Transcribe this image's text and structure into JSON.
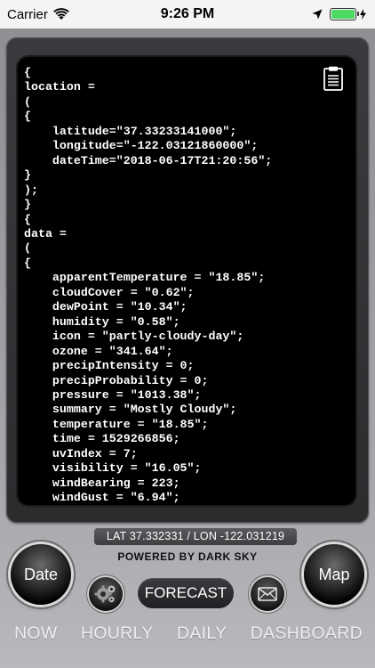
{
  "status_bar": {
    "carrier": "Carrier",
    "time": "9:26 PM"
  },
  "code": {
    "lines": [
      "{",
      "location =",
      "(",
      "{",
      "    latitude=\"37.33233141000\";",
      "    longitude=\"-122.03121860000\";",
      "    dateTime=\"2018-06-17T21:20:56\";",
      "}",
      ");",
      "}",
      "{",
      "data =",
      "(",
      "{",
      "    apparentTemperature = \"18.85\";",
      "    cloudCover = \"0.62\";",
      "    dewPoint = \"10.34\";",
      "    humidity = \"0.58\";",
      "    icon = \"partly-cloudy-day\";",
      "    ozone = \"341.64\";",
      "    precipIntensity = 0;",
      "    precipProbability = 0;",
      "    pressure = \"1013.38\";",
      "    summary = \"Mostly Cloudy\";",
      "    temperature = \"18.85\";",
      "    time = 1529266856;",
      "    uvIndex = 7;",
      "    visibility = \"16.05\";",
      "    windBearing = 223;",
      "    windGust = \"6.94\";"
    ]
  },
  "latlon": "LAT 37.332331 / LON -122.031219",
  "powered_by": "POWERED BY DARK SKY",
  "buttons": {
    "date": "Date",
    "map": "Map",
    "forecast": "FORECAST"
  },
  "tabs": [
    "NOW",
    "HOURLY",
    "DAILY",
    "DASHBOARD"
  ],
  "colors": {
    "battery": "#4cd964",
    "screen_bg": "#000000",
    "code_text": "#ffffff"
  }
}
